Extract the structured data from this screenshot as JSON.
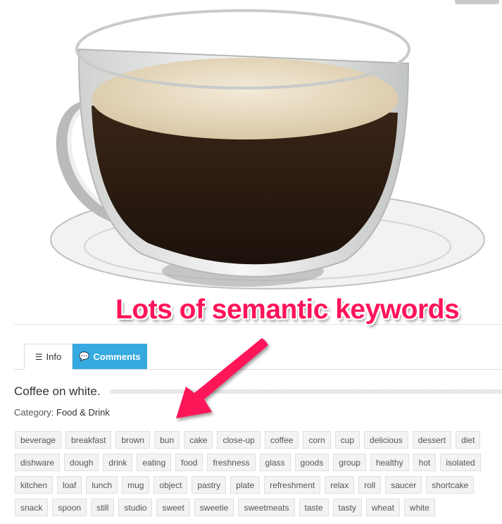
{
  "annotation": {
    "text": "Lots of semantic keywords",
    "color": "#ff1459"
  },
  "tabs": [
    {
      "label": "Info",
      "icon": "list-icon",
      "active": true
    },
    {
      "label": "Comments",
      "icon": "comments-icon",
      "active": false,
      "color": "#36a9e0"
    }
  ],
  "photo": {
    "subject": "Glass cup of coffee on saucer"
  },
  "item": {
    "title": "Coffee on white.",
    "category_label": "Category:",
    "category_value": "Food & Drink"
  },
  "tags": [
    "beverage",
    "breakfast",
    "brown",
    "bun",
    "cake",
    "close-up",
    "coffee",
    "corn",
    "cup",
    "delicious",
    "dessert",
    "diet",
    "dishware",
    "dough",
    "drink",
    "eating",
    "food",
    "freshness",
    "glass",
    "goods",
    "group",
    "healthy",
    "hot",
    "isolated",
    "kitchen",
    "loaf",
    "lunch",
    "mug",
    "object",
    "pastry",
    "plate",
    "refreshment",
    "relax",
    "roll",
    "saucer",
    "shortcake",
    "snack",
    "spoon",
    "still",
    "studio",
    "sweet",
    "sweetie",
    "sweetmeats",
    "taste",
    "tasty",
    "wheat",
    "white"
  ]
}
